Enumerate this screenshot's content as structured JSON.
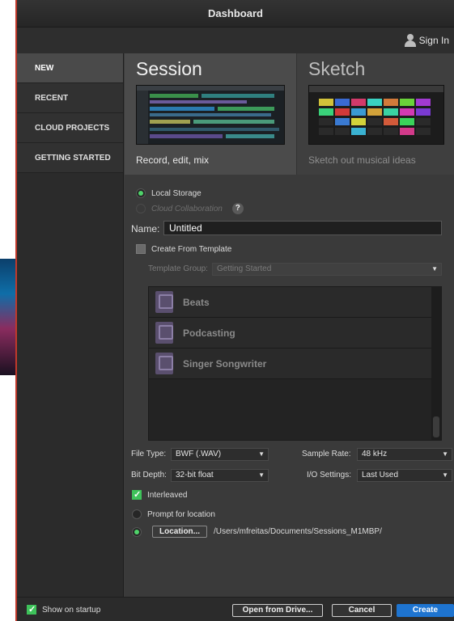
{
  "window": {
    "title": "Dashboard"
  },
  "topbar": {
    "sign_in_label": "Sign In"
  },
  "sidebar": {
    "items": [
      {
        "label": "NEW",
        "active": true
      },
      {
        "label": "RECENT",
        "active": false
      },
      {
        "label": "CLOUD PROJECTS",
        "active": false
      },
      {
        "label": "GETTING STARTED",
        "active": false
      }
    ]
  },
  "cards": {
    "session": {
      "title": "Session",
      "subtitle": "Record, edit, mix"
    },
    "sketch": {
      "title": "Sketch",
      "subtitle": "Sketch out musical ideas"
    }
  },
  "storage": {
    "local_label": "Local Storage",
    "cloud_label": "Cloud Collaboration",
    "help_label": "?"
  },
  "name_field": {
    "label": "Name:",
    "value": "Untitled"
  },
  "template": {
    "checkbox_label": "Create From Template",
    "group_label": "Template Group:",
    "group_value": "Getting Started",
    "items": [
      "Beats",
      "Podcasting",
      "Singer Songwriter"
    ]
  },
  "settings": {
    "file_type_label": "File Type:",
    "file_type_value": "BWF (.WAV)",
    "sample_rate_label": "Sample Rate:",
    "sample_rate_value": "48 kHz",
    "bit_depth_label": "Bit Depth:",
    "bit_depth_value": "32-bit float",
    "io_label": "I/O Settings:",
    "io_value": "Last Used",
    "interleaved_label": "Interleaved"
  },
  "location": {
    "prompt_label": "Prompt for location",
    "button_label": "Location...",
    "path": "/Users/mfreitas/Documents/Sessions_M1MBP/"
  },
  "footer": {
    "show_on_startup_label": "Show on startup",
    "open_drive_label": "Open from Drive...",
    "cancel_label": "Cancel",
    "create_label": "Create"
  },
  "colors": {
    "accent": "#1e74d0",
    "check_green": "#3ec25a",
    "window_bg": "#3c3c3c"
  }
}
